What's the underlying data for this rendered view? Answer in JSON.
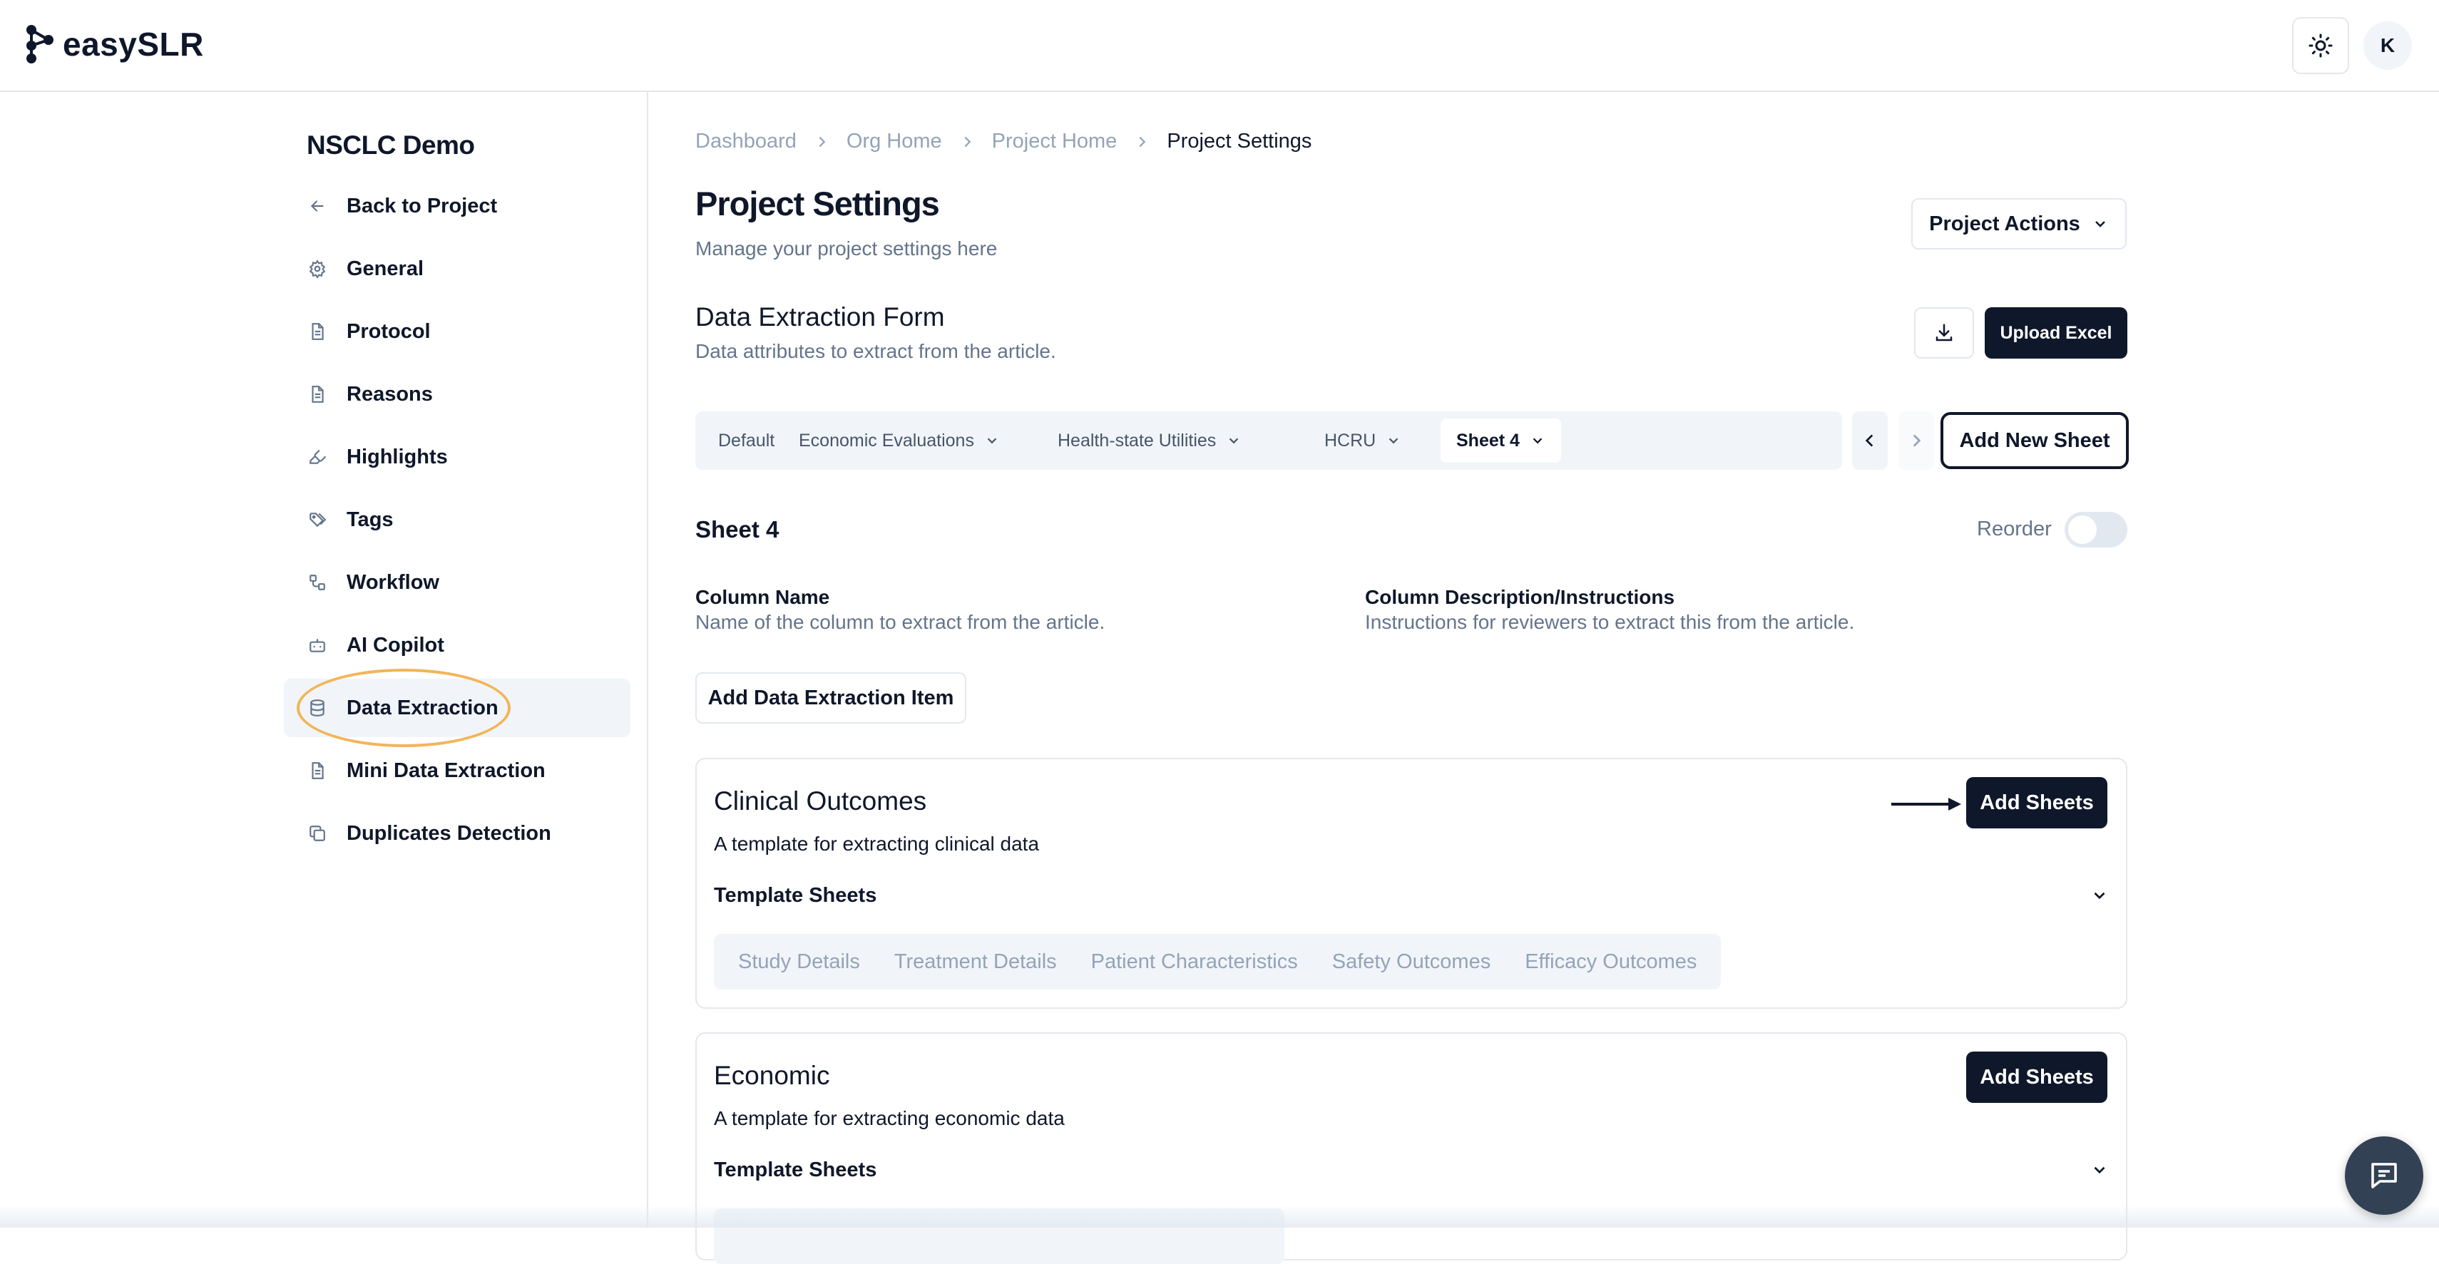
{
  "app": {
    "logo_text": "easySLR",
    "avatar_initial": "K"
  },
  "sidebar": {
    "project_name": "NSCLC Demo",
    "items": [
      {
        "label": "Back to Project",
        "icon": "arrow-left-icon"
      },
      {
        "label": "General",
        "icon": "gear-icon"
      },
      {
        "label": "Protocol",
        "icon": "document-icon"
      },
      {
        "label": "Reasons",
        "icon": "document-icon"
      },
      {
        "label": "Highlights",
        "icon": "highlighter-icon"
      },
      {
        "label": "Tags",
        "icon": "tags-icon"
      },
      {
        "label": "Workflow",
        "icon": "workflow-icon"
      },
      {
        "label": "AI Copilot",
        "icon": "bot-icon"
      },
      {
        "label": "Data Extraction",
        "icon": "database-icon",
        "active": true
      },
      {
        "label": "Mini Data Extraction",
        "icon": "document-icon"
      },
      {
        "label": "Duplicates Detection",
        "icon": "copy-icon"
      }
    ]
  },
  "breadcrumb": [
    "Dashboard",
    "Org Home",
    "Project Home",
    "Project Settings"
  ],
  "header": {
    "title": "Project Settings",
    "subtitle": "Manage your project settings here",
    "actions_label": "Project Actions"
  },
  "form": {
    "title": "Data Extraction Form",
    "subtitle": "Data attributes to extract from the article.",
    "upload_label": "Upload Excel"
  },
  "tabs": [
    {
      "label": "Default",
      "dropdown": false
    },
    {
      "label": "Economic Evaluations",
      "dropdown": true
    },
    {
      "label": "Health-state Utilities",
      "dropdown": true
    },
    {
      "label": "HCRU",
      "dropdown": true
    },
    {
      "label": "Sheet 4",
      "dropdown": true,
      "active": true
    }
  ],
  "add_new_sheet_label": "Add New Sheet",
  "sheet": {
    "title": "Sheet 4",
    "reorder_label": "Reorder",
    "reorder_on": false,
    "col_name_head": "Column Name",
    "col_name_desc": "Name of the column to extract from the article.",
    "col_desc_head": "Column Description/Instructions",
    "col_desc_desc": "Instructions for reviewers to extract this from the article.",
    "add_item_label": "Add Data Extraction Item"
  },
  "templates": [
    {
      "title": "Clinical Outcomes",
      "description": "A template for extracting clinical data",
      "button_label": "Add Sheets",
      "sheets_label": "Template Sheets",
      "sheets": [
        "Study Details",
        "Treatment Details",
        "Patient Characteristics",
        "Safety Outcomes",
        "Efficacy Outcomes"
      ]
    },
    {
      "title": "Economic",
      "description": "A template for extracting economic data",
      "button_label": "Add Sheets",
      "sheets_label": "Template Sheets",
      "sheets": []
    }
  ],
  "colors": {
    "primary": "#0f172a",
    "muted": "#64748b",
    "highlight": "#f2b558",
    "surface": "#f1f5f9"
  }
}
